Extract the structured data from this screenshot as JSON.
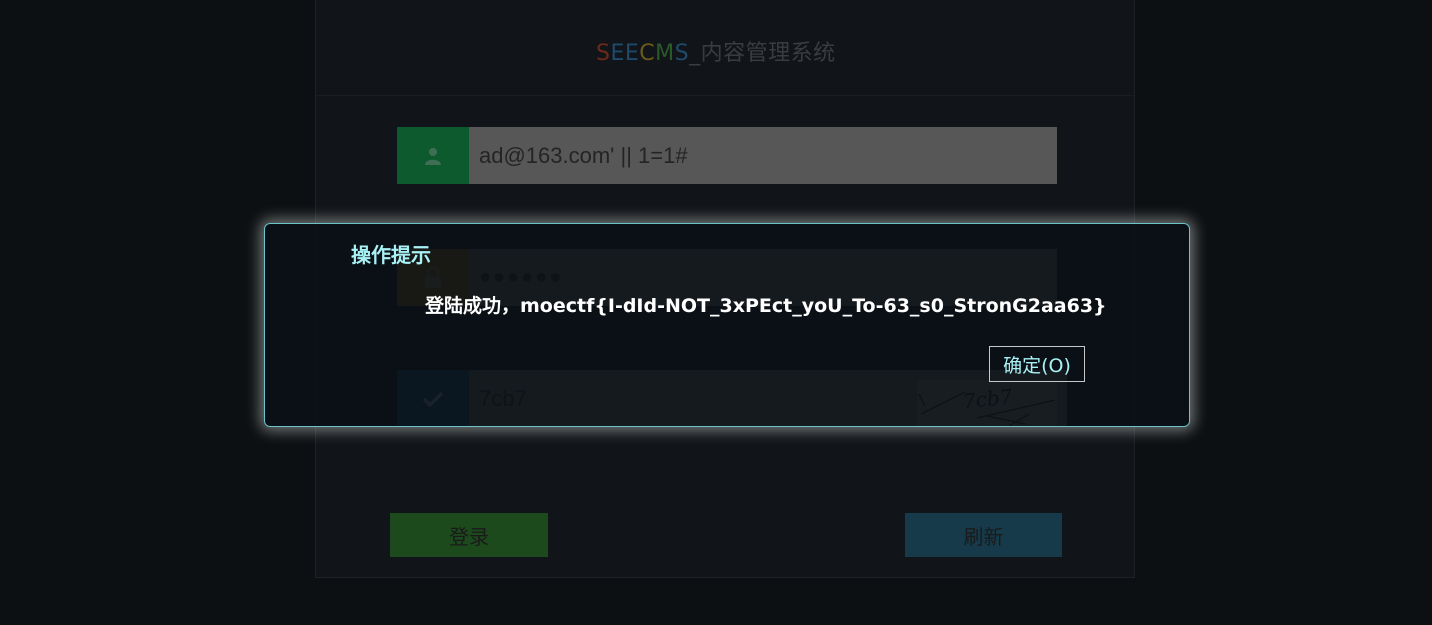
{
  "brand": {
    "letters": [
      "S",
      "E",
      "E",
      "C",
      "M",
      "S"
    ],
    "suffix": "_内容管理系统"
  },
  "login": {
    "username_value": "ad@163.com' || 1=1#",
    "password_value": "●●●●●●",
    "captcha_value": "7cb7",
    "captcha_image_text": "7cb7",
    "login_button": "登录",
    "refresh_button": "刷新",
    "icons": {
      "user": "user-icon",
      "password": "lock-icon",
      "captcha": "check-icon"
    }
  },
  "alert": {
    "title": "操作提示",
    "message": "登陆成功，moectf{I-dId-NOT_3xPEct_yoU_To-63_s0_StronG2aa63}",
    "ok_button": "确定(O)"
  },
  "colors": {
    "alert_title": "#a8f1f5",
    "alert_border": "#6cc3c9",
    "user_icon_bg": "#0d5a2f",
    "password_icon_bg": "#6e4a12",
    "captcha_icon_bg": "#0b3e5b",
    "login_button_bg": "#1c4a1c",
    "refresh_button_bg": "#163a4a"
  }
}
